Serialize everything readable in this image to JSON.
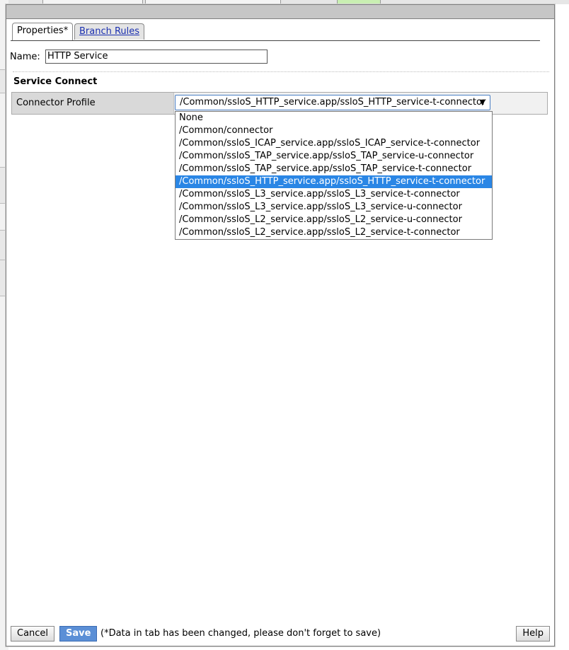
{
  "tabs": [
    {
      "label": "Properties*"
    },
    {
      "label": "Branch Rules"
    }
  ],
  "name_field": {
    "label": "Name:",
    "value": "HTTP Service"
  },
  "section": {
    "title": "Service Connect"
  },
  "connector": {
    "label": "Connector Profile",
    "selected": "/Common/ssloS_HTTP_service.app/ssloS_HTTP_service-t-connector",
    "options": [
      "None",
      "/Common/connector",
      "/Common/ssloS_ICAP_service.app/ssloS_ICAP_service-t-connector",
      "/Common/ssloS_TAP_service.app/ssloS_TAP_service-u-connector",
      "/Common/ssloS_TAP_service.app/ssloS_TAP_service-t-connector",
      "/Common/ssloS_HTTP_service.app/ssloS_HTTP_service-t-connector",
      "/Common/ssloS_L3_service.app/ssloS_L3_service-t-connector",
      "/Common/ssloS_L3_service.app/ssloS_L3_service-u-connector",
      "/Common/ssloS_L2_service.app/ssloS_L2_service-u-connector",
      "/Common/ssloS_L2_service.app/ssloS_L2_service-t-connector"
    ],
    "selected_index": 5
  },
  "footer": {
    "cancel_label": "Cancel",
    "save_label": "Save",
    "note": "(*Data in tab has been changed, please don't forget to save)",
    "help_label": "Help"
  },
  "colors": {
    "selection_highlight": "#2a86e5",
    "save_button": "#5b8fd6",
    "link": "#1a2fb0"
  }
}
